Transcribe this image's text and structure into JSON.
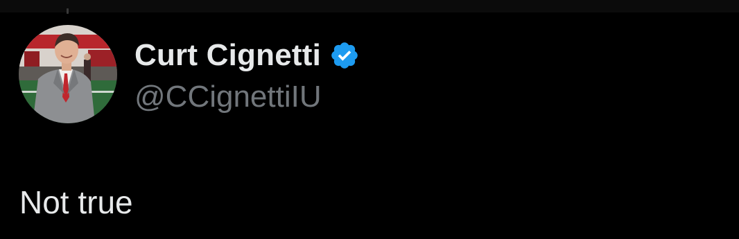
{
  "tweet": {
    "author": {
      "display_name": "Curt Cignetti",
      "handle": "@CCignettiIU",
      "verified": true,
      "verified_icon": "verified-badge-icon",
      "verified_color": "#1d9bf0"
    },
    "text": "Not true"
  },
  "colors": {
    "background": "#000000",
    "primary_text": "#e7e9ea",
    "secondary_text": "#71767b"
  }
}
